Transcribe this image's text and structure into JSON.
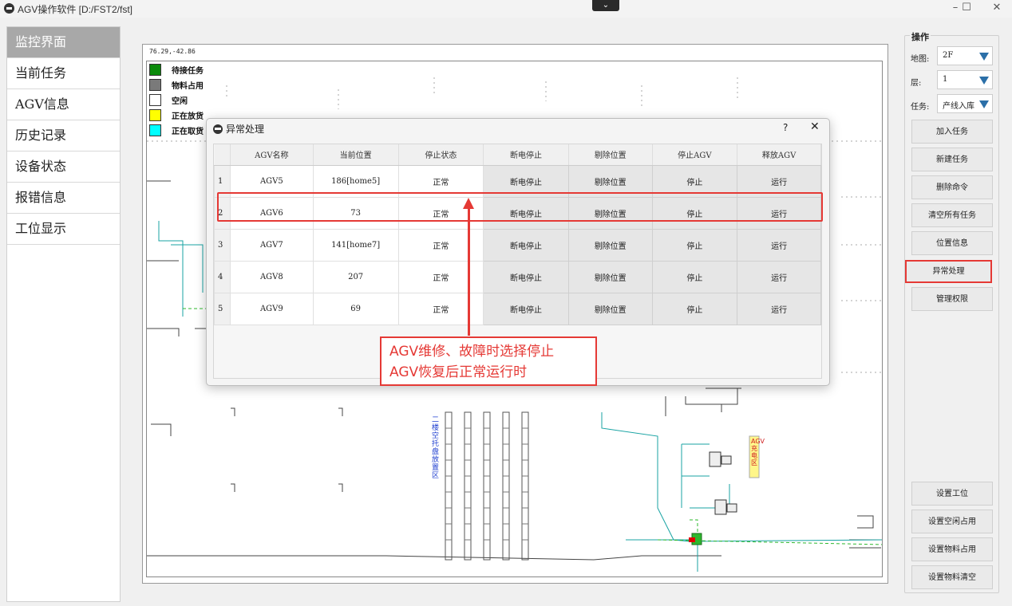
{
  "window": {
    "title": "AGV操作软件 [D:/FST2/fst]",
    "collapse_glyph": "⌄",
    "minimize": "–",
    "maximize": "☐",
    "close": "✕"
  },
  "nav": {
    "items": [
      "监控界面",
      "当前任务",
      "AGV信息",
      "历史记录",
      "设备状态",
      "报错信息",
      "工位显示"
    ],
    "active_index": 0
  },
  "map": {
    "coords": "76.29,-42.86",
    "legend": [
      {
        "label": "待接任务",
        "color": "#0a8a0a"
      },
      {
        "label": "物料占用",
        "color": "#7a7a7a"
      },
      {
        "label": "空闲",
        "color": "#ffffff"
      },
      {
        "label": "正在放货",
        "color": "#ffff00"
      },
      {
        "label": "正在取货",
        "color": "#00ffff"
      }
    ],
    "zone_label": "二楼空托盘放置区",
    "charge_label": "AGV充电区"
  },
  "ops": {
    "group_title": "操作",
    "map_label": "地图:",
    "map_value": "2F",
    "floor_label": "层:",
    "floor_value": "1",
    "task_label": "任务:",
    "task_value": "产线入库",
    "buttons_top": [
      "加入任务",
      "新建任务",
      "删除命令",
      "清空所有任务",
      "位置信息",
      "异常处理",
      "管理权限"
    ],
    "buttons_bottom": [
      "设置工位",
      "设置空闲占用",
      "设置物料占用",
      "设置物料清空"
    ],
    "highlight_color": "#e53935"
  },
  "dialog": {
    "title": "异常处理",
    "help": "?",
    "close": "✕",
    "columns": [
      "AGV名称",
      "当前位置",
      "停止状态",
      "断电停止",
      "剔除位置",
      "停止AGV",
      "释放AGV"
    ],
    "rows": [
      {
        "num": "1",
        "name": "AGV5",
        "pos": "186[home5]",
        "status": "正常",
        "b1": "断电停止",
        "b2": "剔除位置",
        "b3": "停止",
        "b4": "运行"
      },
      {
        "num": "2",
        "name": "AGV6",
        "pos": "73",
        "status": "正常",
        "b1": "断电停止",
        "b2": "剔除位置",
        "b3": "停止",
        "b4": "运行"
      },
      {
        "num": "3",
        "name": "AGV7",
        "pos": "141[home7]",
        "status": "正常",
        "b1": "断电停止",
        "b2": "剔除位置",
        "b3": "停止",
        "b4": "运行"
      },
      {
        "num": "4",
        "name": "AGV8",
        "pos": "207",
        "status": "正常",
        "b1": "断电停止",
        "b2": "剔除位置",
        "b3": "停止",
        "b4": "运行"
      },
      {
        "num": "5",
        "name": "AGV9",
        "pos": "69",
        "status": "正常",
        "b1": "断电停止",
        "b2": "剔除位置",
        "b3": "停止",
        "b4": "运行"
      }
    ]
  },
  "annotation": {
    "line1": "AGV维修、故障时选择停止",
    "line2": "AGV恢复后正常运行时"
  }
}
